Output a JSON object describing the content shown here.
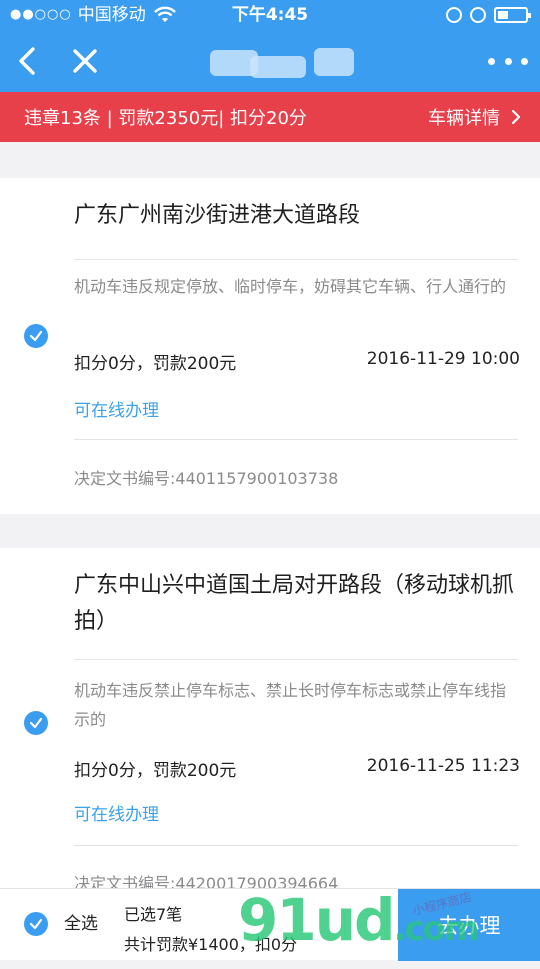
{
  "status_bar": {
    "signal": "●●○○○",
    "carrier": "中国移动",
    "time": "下午4:45",
    "battery_level": 0.4
  },
  "nav": {
    "back_icon": "chevron-left-icon",
    "close_icon": "close-icon",
    "more_icon": "more-dots-icon"
  },
  "summary": {
    "text": "违章13条 | 罚款2350元| 扣分20分",
    "detail_label": "车辆详情"
  },
  "violations": [
    {
      "location": "广东广州南沙街进港大道路段",
      "description": "机动车违反规定停放、临时停车，妨碍其它车辆、行人通行的",
      "penalty": "扣分0分，罚款200元",
      "datetime": "2016-11-29 10:00",
      "online_label": "可在线办理",
      "doc_number": "决定文书编号:4401157900103738"
    },
    {
      "location": "广东中山兴中道国土局对开路段（移动球机抓拍）",
      "description": "机动车违反禁止停车标志、禁止长时停车标志或禁止停车线指示的",
      "penalty": "扣分0分，罚款200元",
      "datetime": "2016-11-25 11:23",
      "online_label": "可在线办理",
      "doc_number": "决定文书编号:4420017900394664"
    }
  ],
  "bottom": {
    "select_all": "全选",
    "selected_count": "已选7笔",
    "total": "共计罚款¥1400，扣0分",
    "go_button": "去办理"
  },
  "watermark": {
    "main": "91ud",
    "suffix": ".com",
    "small": "小程序商店"
  },
  "colors": {
    "primary": "#3b9df0",
    "banner": "#e8404a",
    "link": "#3aa3e8"
  }
}
